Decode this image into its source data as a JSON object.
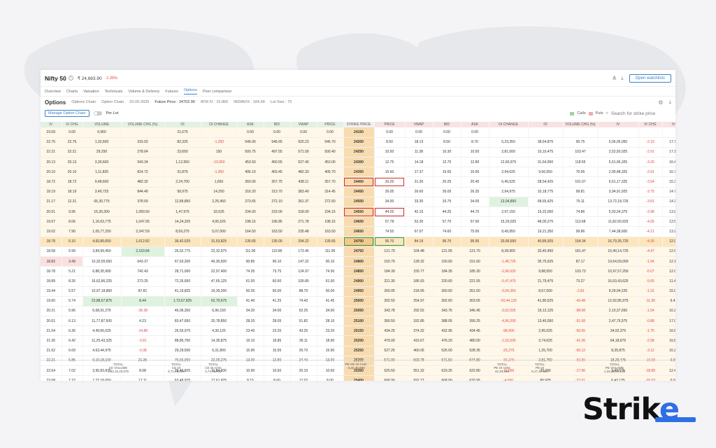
{
  "header": {
    "symbol": "Nifty 50",
    "ltp": "₹ 24,683.90",
    "change": "-1.25%",
    "watchlist_btn": "Open watchlists"
  },
  "tabs": [
    "Overview",
    "Charts",
    "Valuation",
    "Technicals",
    "Volume & Delivery",
    "Futures",
    "Options",
    "Peer comparison"
  ],
  "options_bar": {
    "title": "Options",
    "subtabs": [
      "Options Chain",
      "Option Chain"
    ],
    "date": "22-05-2025",
    "future_price": "Future Price : 24702.90",
    "atm_iv": "ATM IV : 15.865",
    "indiavix": "INDIAVIX : 184.99",
    "lot_size": "Lot Size : 75"
  },
  "sub_bar": {
    "manage_btn": "Manage Option Chain",
    "per_lot": "Per Lot",
    "legend_calls": "Calls",
    "legend_puts": "Puts",
    "search_placeholder": "Search for strike price"
  },
  "colors": {
    "call_header": "#e3f0e3",
    "put_header": "#f8e2e2",
    "strike": "#f8dcaf",
    "atm": "#fde6bd",
    "accent": "#3b82c4"
  },
  "columns": [
    "IV",
    "IV CHG",
    "VOLUME",
    "VOLUME CHG (%)",
    "OI",
    "OI CHANGE",
    "ASK",
    "BID",
    "VWAP",
    "PRICE",
    "STRIKE PRICE",
    "PRICE",
    "VWAP",
    "BID",
    "ASK",
    "OI CHANGE",
    "OI",
    "VOLUME CHG (%)",
    "IV",
    "IV CHG",
    "IV"
  ],
  "rows": [
    [
      "23.09",
      "0.00",
      "6,950",
      "",
      "21,675",
      "",
      "0.00",
      "0.00",
      "0.00",
      "0.00",
      "24150",
      "0.00",
      "0.00",
      "0.00",
      "0.00",
      "",
      "",
      "",
      "",
      "",
      ""
    ],
    [
      "22.76",
      "22.76",
      "1,32,600",
      "315.02",
      "82,325",
      "-1,200",
      "546.00",
      "546.65",
      "620.23",
      "546.70",
      "24200",
      "8.50",
      "18.13",
      "8.50",
      "8.70",
      "5,23,350",
      "38,64,875",
      "90.75",
      "5,06,05,050",
      "-2.19",
      "17.70"
    ],
    [
      "22.21",
      "22.21",
      "29,250",
      "278.64",
      "23,650",
      "150",
      "500.75",
      "497.55",
      "571.09",
      "500.40",
      "24250",
      "10.50",
      "11.38",
      "10.30",
      "10.50",
      "2,81,000",
      "10,10,475",
      "103.47",
      "2,52,50,025",
      "-2.91",
      "17.16"
    ],
    [
      "20.13",
      "20.13",
      "3,30,600",
      "543.34",
      "1,12,950",
      "-10,950",
      "453.50",
      "450.55",
      "527.40",
      "453.00",
      "24300",
      "12.75",
      "14.18",
      "12.70",
      "12.80",
      "12,60,975",
      "31,64,950",
      "118.55",
      "5,51,96,325",
      "-3.20",
      "16.46"
    ],
    [
      "20.10",
      "20.10",
      "1,11,825",
      "814.72",
      "31,875",
      "-1,950",
      "406.10",
      "403.45",
      "482.33",
      "405.70",
      "24350",
      "15.60",
      "17.37",
      "15.65",
      "15.95",
      "2,94,625",
      "9,56,550",
      "70.95",
      "2,90,48,325",
      "-2.91",
      "16.79"
    ],
    [
      "18.72",
      "18.72",
      "9,48,600",
      "482.32",
      "2,24,700",
      "1,650",
      "360.00",
      "357.75",
      "438.11",
      "357.70",
      "24400",
      "20.25",
      "21.30",
      "20.25",
      "20.45",
      "6,45,525",
      "28,54,425",
      "101.07",
      "6,51,17,325",
      "-3.54",
      "15.30"
    ],
    [
      "18.19",
      "18.19",
      "3,49,725",
      "844.49",
      "99,975",
      "14,250",
      "316.20",
      "313.70",
      "383.40",
      "314.45",
      "24450",
      "26.05",
      "26.60",
      "26.05",
      "26.35",
      "2,94,975",
      "10,18,775",
      "99.81",
      "3,94,91,925",
      "-3.75",
      "14.79"
    ],
    [
      "21.17",
      "12.31",
      "65,30,775",
      "378.59",
      "12,89,850",
      "2,25,450",
      "273.65",
      "272.10",
      "351.37",
      "272.50",
      "24500",
      "34.00",
      "33.35",
      "33.75",
      "34.05",
      "13,04,850",
      "68,65,425",
      "75.11",
      "13,72,18,725",
      "-3.81",
      "14.36"
    ],
    [
      "20.51",
      "9.95",
      "15,30,300",
      "1,083.50",
      "1,47,975",
      "32,625",
      "234.00",
      "233.00",
      "318.00",
      "234.15",
      "24550",
      "44.25",
      "42.15",
      "44.25",
      "44.70",
      "2,97,150",
      "15,22,050",
      "74.86",
      "5,03,34,375",
      "-3.98",
      "13.94"
    ],
    [
      "19.57",
      "8.06",
      "1,16,63,775",
      "1,047.05",
      "14,24,325",
      "4,95,525",
      "198.15",
      "196.85",
      "271.78",
      "198.15",
      "24600",
      "57.78",
      "53.30",
      "57.70",
      "57.90",
      "15,29,025",
      "48,00,275",
      "113.68",
      "11,82,50,925",
      "-4.05",
      "13.59"
    ],
    [
      "19.02",
      "7.90",
      "1,05,77,250",
      "2,347.59",
      "8,59,275",
      "5,07,000",
      "164.50",
      "163.50",
      "235.48",
      "163.50",
      "24650",
      "74.55",
      "67.07",
      "74.60",
      "75.00",
      "9,49,950",
      "19,21,350",
      "99.86",
      "7,44,38,600",
      "-4.21",
      "13.24"
    ],
    [
      "18.78",
      "6.16",
      "4,60,89,650",
      "1,612.82",
      "36,42,525",
      "31,53,825",
      "135.65",
      "135.00",
      "204.22",
      "135.65",
      "24700",
      "95.70",
      "84.15",
      "95.70",
      "95.95",
      "33,66,550",
      "40,85,925",
      "154.34",
      "16,79,35,725",
      "-4.30",
      "12.95"
    ],
    [
      "18.58",
      "5.99",
      "3,84,99,450",
      "2,163.84",
      "26,52,775",
      "22,32,975",
      "111.00",
      "110.85",
      "173.45",
      "111.00",
      "24750",
      "121.79",
      "104.48",
      "121.05",
      "121.70",
      "8,28,900",
      "20,40,450",
      "181.47",
      "10,40,14,725",
      "-4.47",
      "12.69"
    ],
    [
      "18.82",
      "3.49",
      "10,32,55,650",
      "643.37",
      "67,63,200",
      "49,30,500",
      "90.85",
      "90.10",
      "147.22",
      "90.10",
      "24800",
      "150.79",
      "128.32",
      "150.60",
      "151.60",
      "-1,48,725",
      "35,75,625",
      "87.17",
      "19,54,59,000",
      "-1.94",
      "12.14"
    ],
    [
      "18.78",
      "5.21",
      "6,88,35,900",
      "742.43",
      "28,71,000",
      "22,97,400",
      "74.35",
      "73.75",
      "124.97",
      "74.30",
      "24850",
      "184.39",
      "155.77",
      "184.35",
      "185.30",
      "-2,96,625",
      "9,88,550",
      "103.73",
      "10,97,57,250",
      "-5.07",
      "12.01"
    ],
    [
      "18.89",
      "8.26",
      "16,62,86,225",
      "273.25",
      "72,26,650",
      "47,65,125",
      "61.00",
      "60.60",
      "105.80",
      "61.00",
      "24900",
      "221.30",
      "185.93",
      "220.60",
      "221.55",
      "-5,47,475",
      "21,79,475",
      "73.27",
      "16,63,43,625",
      "-5.69",
      "11.47"
    ],
    [
      "19.44",
      "5.57",
      "10,97,18,850",
      "87.81",
      "41,19,825",
      "19,39,200",
      "50.35",
      "50.00",
      "88.70",
      "50.00",
      "24950",
      "260.05",
      "218.95",
      "260.60",
      "261.60",
      "-6,64,350",
      "8,67,000",
      "-2.81",
      "9,29,04,225",
      "-1.31",
      "15.00"
    ],
    [
      "19.60",
      "5.74",
      "23,88,67,875",
      "8.44",
      "1,73,67,825",
      "62,70,675",
      "41.40",
      "41.25",
      "74.42",
      "41.45",
      "25000",
      "302.50",
      "254.97",
      "302.60",
      "303.65",
      "-20,44,125",
      "41,80,525",
      "-43.48",
      "12,92,85,975",
      "-11.90",
      "6.42"
    ],
    [
      "20.21",
      "5.96",
      "6,68,91,275",
      "-36.38",
      "46,06,350",
      "6,96,150",
      "34.20",
      "34.00",
      "62.25",
      "34.00",
      "25050",
      "343.78",
      "292.52",
      "343.75",
      "346.45",
      "-3,02,025",
      "19,12,125",
      "-88.08",
      "2,10,37,650",
      "-1.54",
      "16.20"
    ],
    [
      "20.61",
      "6.13",
      "11,77,87,500",
      "4.23",
      "83,47,650",
      "20,78,850",
      "28.20",
      "28.05",
      "51.82",
      "28.10",
      "25100",
      "390.50",
      "332.85",
      "388.05",
      "390.25",
      "-4,96,200",
      "13,45,050",
      "-51.68",
      "2,47,75,575",
      "-0.88",
      "17.05"
    ],
    [
      "21.04",
      "6.36",
      "4,49,66,025",
      "-14.88",
      "26,55,075",
      "4,30,125",
      "23.40",
      "23.20",
      "43.25",
      "23.20",
      "25150",
      "434.25",
      "374.32",
      "432.95",
      "434.45",
      "-98,400",
      "2,95,025",
      "-66.55",
      "34,92,375",
      "-1.75",
      "16.64"
    ],
    [
      "21.36",
      "6.42",
      "11,25,43,325",
      "-3.81",
      "88,85,700",
      "14,35,875",
      "19.10",
      "18.85",
      "36.11",
      "18.90",
      "25200",
      "479.00",
      "415.67",
      "476.20",
      "480.00",
      "-1,63,500",
      "3,74,625",
      "-41.06",
      "64,18,675",
      "-2.58",
      "16.82"
    ],
    [
      "21.62",
      "6.69",
      "4,63,44,975",
      "-0.38",
      "29,29,500",
      "6,31,800",
      "15.90",
      "15.55",
      "29.70",
      "15.90",
      "25250",
      "527.25",
      "460.05",
      "525.00",
      "528.35",
      "-25,275",
      "1,25,700",
      "-65.12",
      "8,35,875",
      "-3.12",
      "16.21"
    ],
    [
      "22.21",
      "6.85",
      "9,19,18,100",
      "21.35",
      "76,66,000",
      "22,09,275",
      "13.00",
      "12.80",
      "24.40",
      "13.00",
      "25300",
      "571.00",
      "503.78",
      "571.50",
      "574.80",
      "-86,375",
      "2,81,750",
      "-50.89",
      "18,29,475",
      "-19.98",
      "0.00"
    ],
    [
      "22.64",
      "7.02",
      "3,95,83,875",
      "8.08",
      "29,46,825",
      "11,84,600",
      "10.90",
      "10.60",
      "20.10",
      "10.60",
      "25350",
      "620.50",
      "551.32",
      "619.25",
      "622.80",
      "-11,550",
      "23,700",
      "-17.96",
      "3,49,575",
      "-18.89",
      "12.42"
    ],
    [
      "23.08",
      "7.22",
      "7,72,18,050",
      "17.11",
      "63,48,975",
      "17,61,825",
      "8.15",
      "8.00",
      "17.02",
      "8.00",
      "25400",
      "668.90",
      "597.77",
      "668.00",
      "670.95",
      "-4,650",
      "80,925",
      "-27.61",
      "6,43,125",
      "-20.03",
      "0.00"
    ],
    [
      "23.57",
      "7.41",
      "3,24,48,825",
      "-3.89",
      "23,50,500",
      "7,04,325",
      "7.65",
      "7.35",
      "13.67",
      "7.60",
      "25450",
      "721.70",
      "650.00",
      "718.00",
      "720.60",
      "-3,750",
      "15,975",
      "-44.40",
      "55,875",
      "-22.13",
      "0.00"
    ]
  ],
  "totals": [
    {
      "label": "TOTAL",
      "sub": "CE VOLUME",
      "value": "1,42,16,23,075"
    },
    {
      "label": "TOTAL",
      "sub": "CE OI",
      "value": "8,71,98,025"
    },
    {
      "label": "TOTAL",
      "sub": "CE OI CHG",
      "value": "3,74,75,025"
    },
    {
      "label": "PE-CE OI CHG",
      "sub": "",
      "value": "-3,32,40,800"
    },
    {
      "label": "TOTAL",
      "sub": "PE OI CHG",
      "value": "42,34,425"
    },
    {
      "label": "TOTAL",
      "sub": "PE OI",
      "value": "5,17,17,350"
    },
    {
      "label": "TOTAL",
      "sub": "PE VOLUME",
      "value": "1,34,34,67,100"
    }
  ],
  "brand": {
    "logo_text": "Strike"
  }
}
